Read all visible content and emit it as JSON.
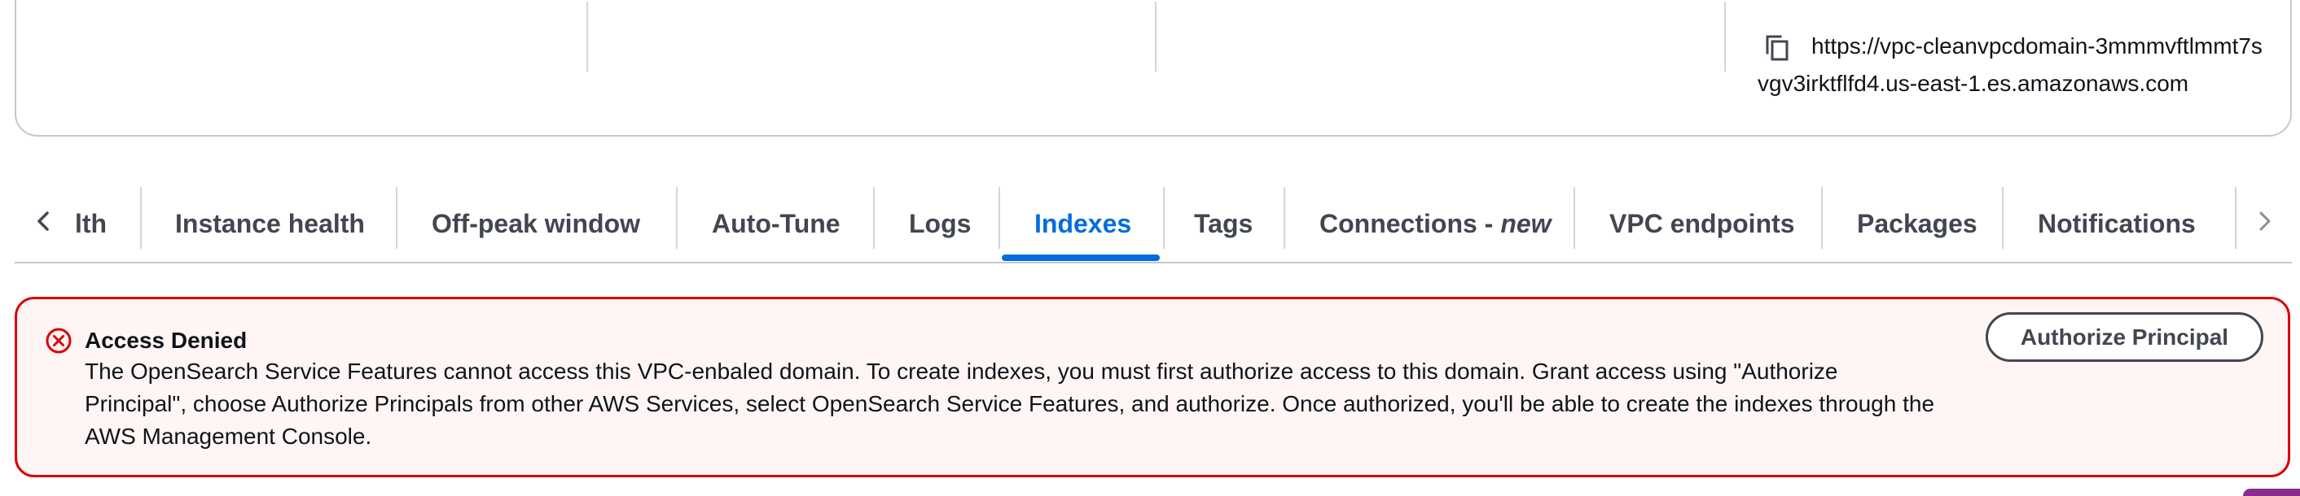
{
  "details": {
    "endpoint_url": "https://vpc-cleanvpcdomain-3mmmvftlmmt7svgv3irktflfd4.us-east-1.es.amazonaws.com",
    "copy_icon": "copy-icon"
  },
  "tabs": {
    "scroll_left_icon": "chevron-left-icon",
    "scroll_right_icon": "chevron-right-icon",
    "items": [
      {
        "label": "lth",
        "active": false
      },
      {
        "label": "Instance health",
        "active": false
      },
      {
        "label": "Off-peak window",
        "active": false
      },
      {
        "label": "Auto-Tune",
        "active": false
      },
      {
        "label": "Logs",
        "active": false
      },
      {
        "label": "Indexes",
        "active": true
      },
      {
        "label": "Tags",
        "active": false
      },
      {
        "label": "Connections -",
        "suffix": "new",
        "active": false
      },
      {
        "label": "VPC endpoints",
        "active": false
      },
      {
        "label": "Packages",
        "active": false
      },
      {
        "label": "Notifications",
        "active": false
      }
    ]
  },
  "alert": {
    "type": "error",
    "icon": "error-circle-icon",
    "title": "Access Denied",
    "message": "The OpenSearch Service Features cannot access this VPC-enbaled domain. To create indexes, you must first authorize access to this domain. Grant access using \"Authorize Principal\", choose Authorize Principals from other AWS Services, select OpenSearch Service Features, and authorize. Once authorized, you'll be able to create the indexes through the AWS Management Console.",
    "action_label": "Authorize Principal"
  },
  "colors": {
    "accent": "#006ce0",
    "error": "#db0000",
    "error_background": "#fff5f5",
    "tab_text": "#424650"
  }
}
